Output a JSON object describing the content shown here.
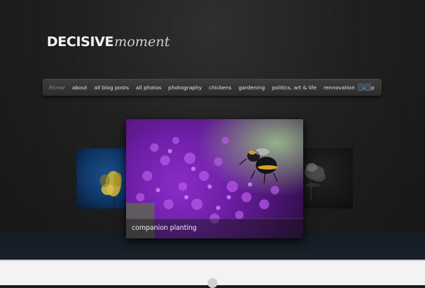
{
  "logo": {
    "bold": "DECISIVE",
    "italic": "moment"
  },
  "nav": {
    "items": [
      "Home",
      "about",
      "all blog posts",
      "all photos",
      "photography",
      "chickens",
      "gardening",
      "politics, art & life",
      "rennovation",
      "shop"
    ],
    "active": "Home"
  },
  "slider": {
    "caption": "companion planting",
    "slides": [
      "yellow flower on blue background",
      "purple flowers with bumblebee",
      "dark flower"
    ]
  },
  "icons": {
    "feed": "rss-icon"
  },
  "colors": {
    "background": "#1c1c1c",
    "nav_bar": "#353535",
    "accent_band": "#151b24",
    "footer": "#f3f3f3"
  }
}
